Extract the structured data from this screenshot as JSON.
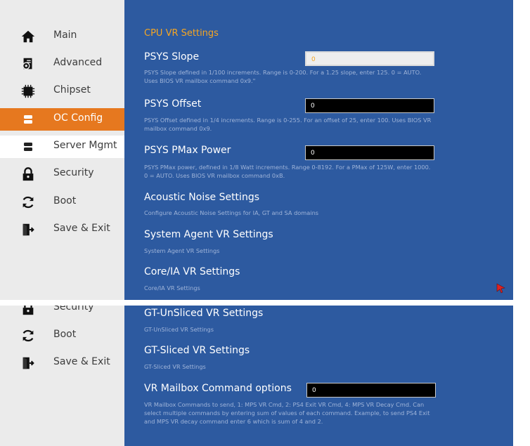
{
  "sidebar_top": {
    "items": [
      {
        "label": "Main",
        "icon": "home-icon"
      },
      {
        "label": "Advanced",
        "icon": "gear-document-icon"
      },
      {
        "label": "Chipset",
        "icon": "chip-icon"
      },
      {
        "label": "OC Config",
        "icon": "server-icon",
        "state": "active"
      },
      {
        "label": "Server Mgmt",
        "icon": "server-icon",
        "state": "hover"
      },
      {
        "label": "Security",
        "icon": "lock-icon"
      },
      {
        "label": "Boot",
        "icon": "refresh-icon"
      },
      {
        "label": "Save & Exit",
        "icon": "exit-icon"
      }
    ]
  },
  "sidebar_bottom": {
    "items": [
      {
        "label": "Security",
        "icon": "lock-icon"
      },
      {
        "label": "Boot",
        "icon": "refresh-icon"
      },
      {
        "label": "Save & Exit",
        "icon": "exit-icon"
      }
    ]
  },
  "main_top": {
    "section_title": "CPU VR Settings",
    "settings": [
      {
        "label": "PSYS Slope",
        "value": "0",
        "desc": "PSYS Slope defined in 1/100 increments. Range is 0-200. For a 1.25 slope, enter 125. 0 = AUTO. Uses BIOS VR mailbox command 0x9.\""
      },
      {
        "label": "PSYS Offset",
        "value": "0",
        "desc": "PSYS Offset defined in 1/4 increments. Range is 0-255. For an offset of 25, enter 100. Uses BIOS VR mailbox command 0x9."
      },
      {
        "label": "PSYS PMax Power",
        "value": "0",
        "desc": "PSYS PMax power, defined in 1/8 Watt increments. Range 0-8192. For a PMax of 125W, enter 1000. 0 = AUTO. Uses BIOS VR mailbox command 0xB."
      }
    ],
    "submenus": [
      {
        "label": "Acoustic Noise Settings",
        "desc": "Configure Acoustic Noise Settings for IA, GT and SA domains"
      },
      {
        "label": "System Agent VR Settings",
        "desc": "System Agent VR Settings"
      },
      {
        "label": "Core/IA VR Settings",
        "desc": "Core/IA VR Settings"
      }
    ]
  },
  "main_bottom": {
    "submenus": [
      {
        "label": "GT-UnSliced VR Settings",
        "desc": "GT-UnSliced VR Settings"
      },
      {
        "label": "GT-Sliced VR Settings",
        "desc": "GT-Sliced VR Settings"
      }
    ],
    "mailbox": {
      "label": "VR Mailbox Command options",
      "value": "0",
      "desc": "VR Mailbox Commands to send, 1: MPS VR Cmd, 2: PS4 Exit VR Cmd, 4: MPS VR Decay Cmd. Can select multiple commands by entering sum of values of each command. Example, to send PS4 Exit and MPS VR decay command enter 6 which is sum of 4 and 2."
    }
  },
  "colors": {
    "main_bg": "#2d5aa0",
    "accent": "#e6781f",
    "section_title": "#f5a623",
    "description": "#9fb4d9",
    "sidebar_bg": "#ebebeb"
  }
}
